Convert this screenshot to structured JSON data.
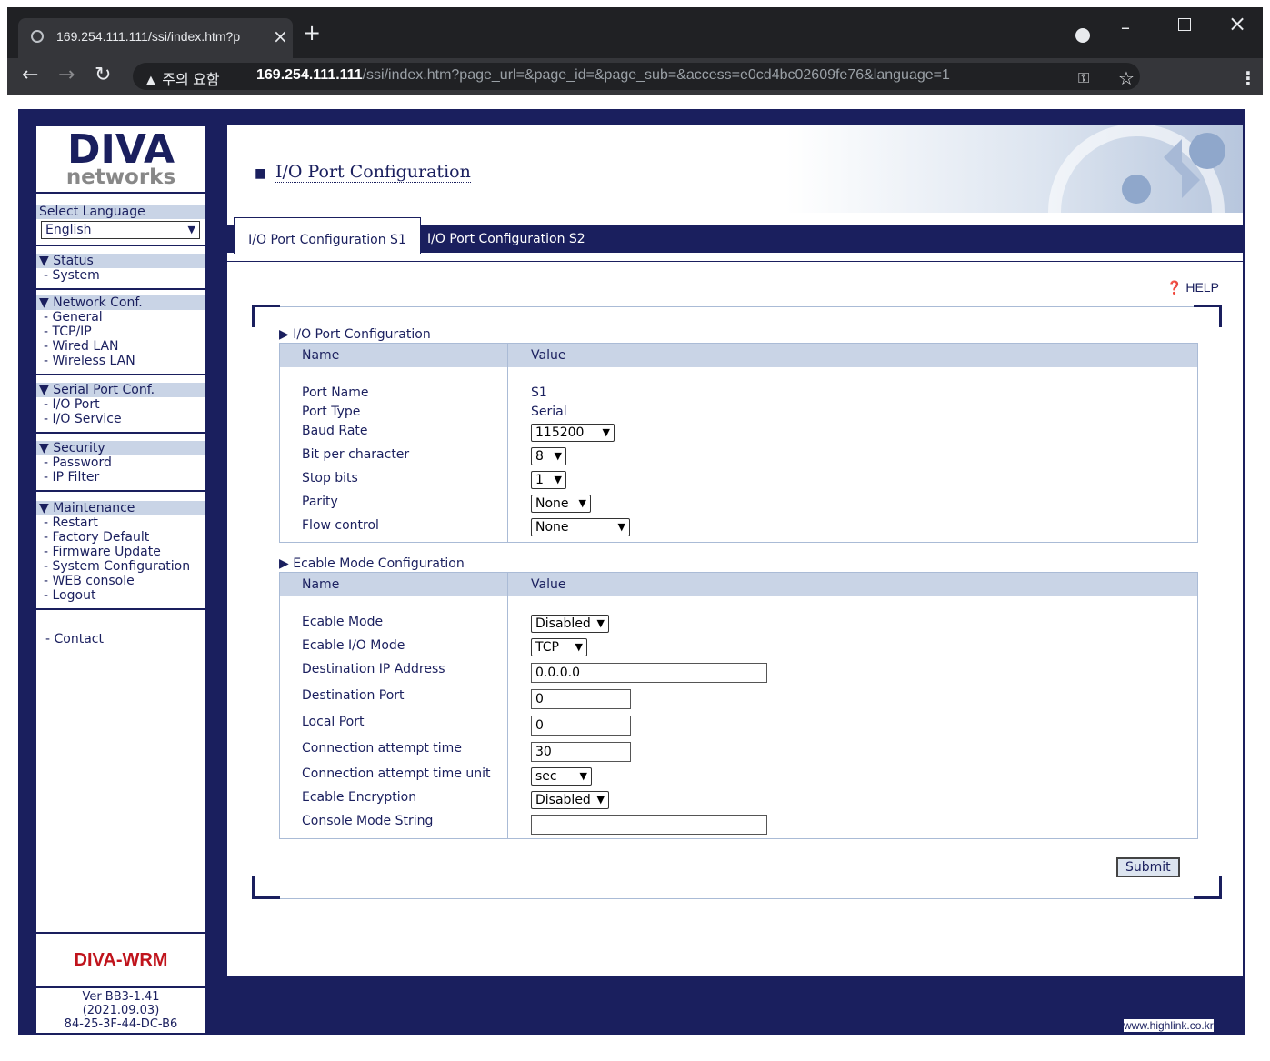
{
  "browser": {
    "tab_title": "169.254.111.111/ssi/index.htm?p",
    "new_tab": "+",
    "security_warning": "▲ 주의 요함",
    "url_host": "169.254.111.111",
    "url_path": "/ssi/index.htm?page_url=&page_id=&page_sub=&access=e0cd4bc02609fe76&language=1"
  },
  "sidebar": {
    "logo_main": "DIVA",
    "logo_sub": "networks",
    "language_label": "Select Language",
    "language_value": "English",
    "sections": [
      {
        "title": "▼ Status",
        "items": [
          "- System"
        ]
      },
      {
        "title": "▼ Network Conf.",
        "items": [
          "- General",
          "- TCP/IP",
          "- Wired LAN",
          "- Wireless LAN"
        ]
      },
      {
        "title": "▼ Serial Port Conf.",
        "items": [
          "- I/O Port",
          "- I/O Service"
        ]
      },
      {
        "title": "▼ Security",
        "items": [
          "- Password",
          "- IP Filter"
        ]
      },
      {
        "title": "▼ Maintenance",
        "items": [
          "- Restart",
          "- Factory Default",
          "- Firmware Update",
          "- System Configuration",
          "- WEB console",
          "- Logout"
        ]
      }
    ],
    "contact": "-  Contact",
    "model": "DIVA-WRM",
    "version": "Ver BB3-1.41",
    "date": "(2021.09.03)",
    "mac": "84-25-3F-44-DC-B6"
  },
  "main": {
    "title": "I/O Port Configuration",
    "tabs": [
      "I/O Port Configuration S1",
      "I/O Port Configuration S2"
    ],
    "help": "HELP",
    "io_section": {
      "title": "I/O Port Configuration",
      "col_name": "Name",
      "col_value": "Value",
      "rows": {
        "port_name_label": "Port Name",
        "port_name_value": "S1",
        "port_type_label": "Port Type",
        "port_type_value": "Serial",
        "baud_label": "Baud Rate",
        "baud_value": "115200",
        "bits_label": "Bit per character",
        "bits_value": "8",
        "stop_label": "Stop bits",
        "stop_value": "1",
        "parity_label": "Parity",
        "parity_value": "None",
        "flow_label": "Flow control",
        "flow_value": "None"
      }
    },
    "ecable_section": {
      "title": "Ecable Mode Configuration",
      "col_name": "Name",
      "col_value": "Value",
      "rows": {
        "mode_label": "Ecable Mode",
        "mode_value": "Disabled",
        "io_mode_label": "Ecable I/O Mode",
        "io_mode_value": "TCP",
        "dest_ip_label": "Destination IP Address",
        "dest_ip_value": "0.0.0.0",
        "dest_port_label": "Destination Port",
        "dest_port_value": "0",
        "local_port_label": "Local Port",
        "local_port_value": "0",
        "conn_time_label": "Connection attempt time",
        "conn_time_value": "30",
        "conn_unit_label": "Connection attempt time unit",
        "conn_unit_value": "sec",
        "enc_label": "Ecable Encryption",
        "enc_value": "Disabled",
        "console_label": "Console Mode String",
        "console_value": ""
      }
    },
    "submit": "Submit",
    "footer_url": "www.highlink.co.kr"
  }
}
